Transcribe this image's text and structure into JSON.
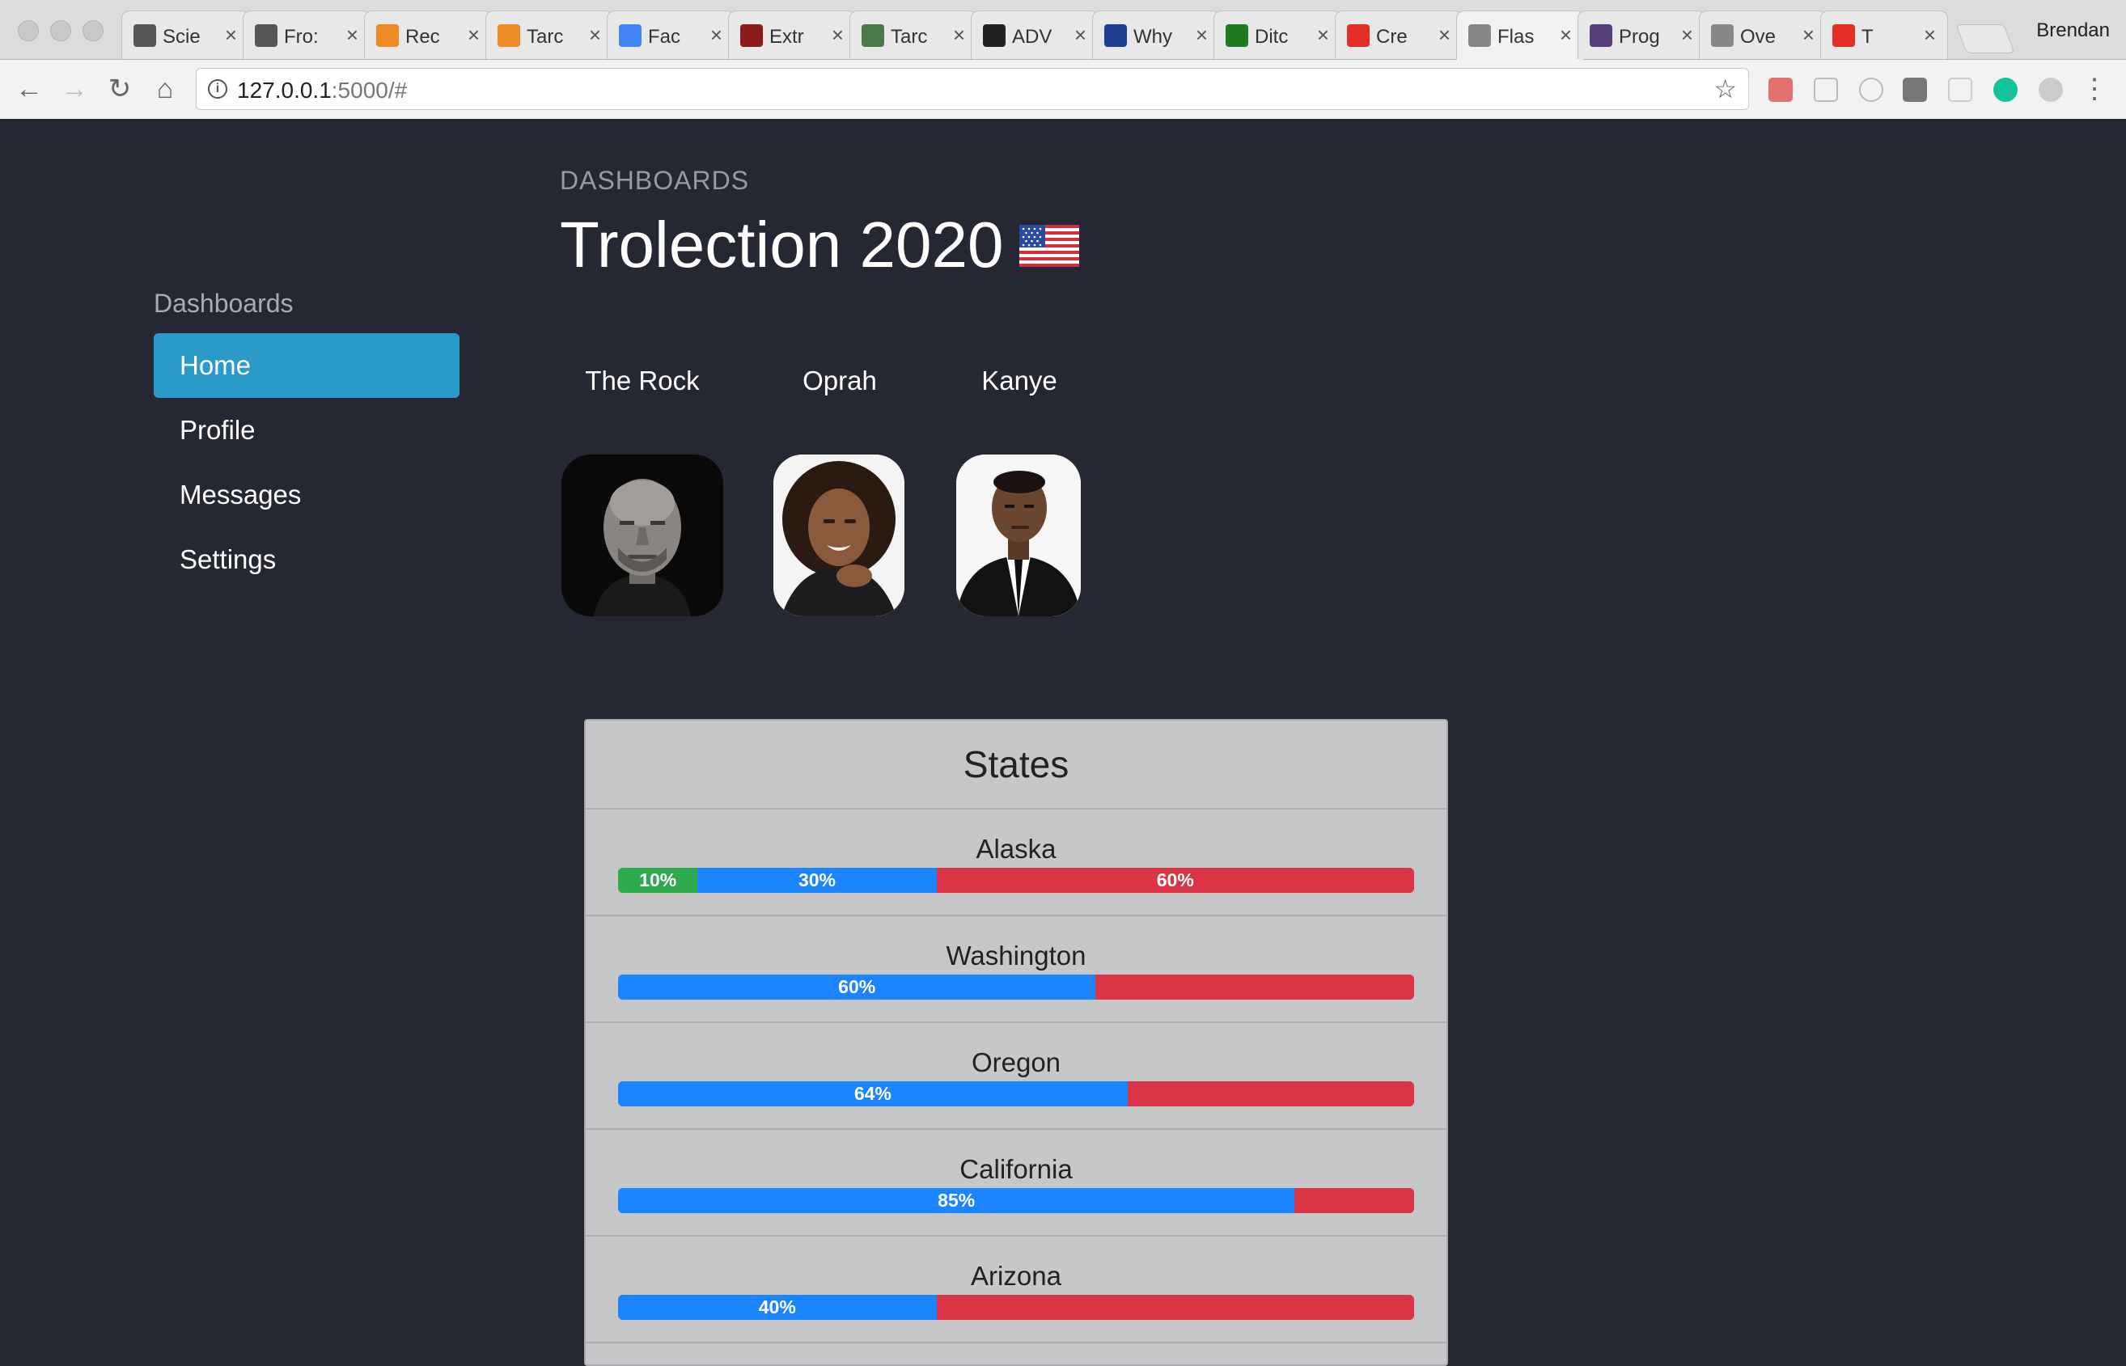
{
  "browser": {
    "tabs": [
      {
        "title": "Scie",
        "icon": "folder-face-icon",
        "color": "#555555"
      },
      {
        "title": "Fro:",
        "icon": "folder-face-icon",
        "color": "#555555"
      },
      {
        "title": "Rec",
        "icon": "letter-e-icon",
        "color": "#f08a24"
      },
      {
        "title": "Tarc",
        "icon": "letter-e-icon",
        "color": "#f08a24"
      },
      {
        "title": "Fac",
        "icon": "google-icon",
        "color": "#4285f4"
      },
      {
        "title": "Extr",
        "icon": "letter-n-icon",
        "color": "#8b1a1a"
      },
      {
        "title": "Tarc",
        "icon": "grid-logo-icon",
        "color": "#4a7a4a"
      },
      {
        "title": "ADV",
        "icon": "paw-icon",
        "color": "#222222"
      },
      {
        "title": "Why",
        "icon": "nasa-icon",
        "color": "#1c3f94"
      },
      {
        "title": "Ditc",
        "icon": "green-box-icon",
        "color": "#1e7a1e"
      },
      {
        "title": "Cre",
        "icon": "youtube-icon",
        "color": "#e52d27"
      },
      {
        "title": "Flas",
        "icon": "document-icon",
        "color": "#888888",
        "active": true
      },
      {
        "title": "Prog",
        "icon": "bootstrap-icon",
        "color": "#563d7c"
      },
      {
        "title": "Ove",
        "icon": "document-icon",
        "color": "#888888"
      },
      {
        "title": "T",
        "icon": "youtube-icon",
        "color": "#e52d27"
      }
    ],
    "profile_name": "Brendan",
    "url_host": "127.0.0.1",
    "url_rest": ":5000/#"
  },
  "sidebar": {
    "heading": "Dashboards",
    "items": [
      {
        "label": "Home",
        "active": true
      },
      {
        "label": "Profile"
      },
      {
        "label": "Messages"
      },
      {
        "label": "Settings"
      }
    ]
  },
  "header": {
    "breadcrumb": "DASHBOARDS",
    "title": "Trolection 2020"
  },
  "candidates": [
    {
      "name": "The Rock"
    },
    {
      "name": "Oprah"
    },
    {
      "name": "Kanye"
    }
  ],
  "states": {
    "title": "States",
    "rows": [
      {
        "name": "Alaska",
        "segments": [
          {
            "value": 10,
            "label": "10%",
            "color": "green"
          },
          {
            "value": 30,
            "label": "30%",
            "color": "blue"
          },
          {
            "value": 60,
            "label": "60%",
            "color": "red"
          }
        ]
      },
      {
        "name": "Washington",
        "segments": [
          {
            "value": 60,
            "label": "60%",
            "color": "blue"
          },
          {
            "value": 40,
            "label": "",
            "color": "red"
          }
        ]
      },
      {
        "name": "Oregon",
        "segments": [
          {
            "value": 64,
            "label": "64%",
            "color": "blue"
          },
          {
            "value": 36,
            "label": "",
            "color": "red"
          }
        ]
      },
      {
        "name": "California",
        "segments": [
          {
            "value": 85,
            "label": "85%",
            "color": "blue"
          },
          {
            "value": 15,
            "label": "",
            "color": "red"
          }
        ]
      },
      {
        "name": "Arizona",
        "segments": [
          {
            "value": 40,
            "label": "40%",
            "color": "blue"
          },
          {
            "value": 60,
            "label": "",
            "color": "red"
          }
        ]
      }
    ]
  },
  "colors": {
    "accent": "#2a9ac9",
    "green": "#2eaa4e",
    "blue": "#1b85ff",
    "red": "#dc3545",
    "background": "#252832"
  }
}
